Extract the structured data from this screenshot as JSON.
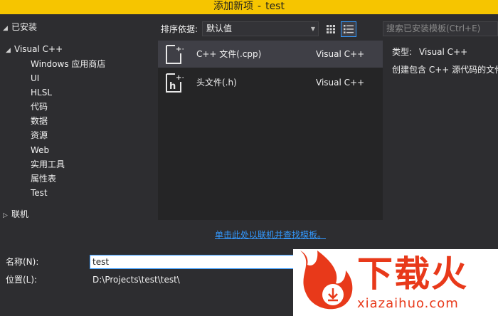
{
  "window": {
    "title": "添加新项",
    "project": "test"
  },
  "tree": {
    "installed": {
      "label": "已安装",
      "expanded": true
    },
    "visual_cpp": {
      "label": "Visual C++",
      "children": [
        "Windows 应用商店",
        "UI",
        "HLSL",
        "代码",
        "数据",
        "资源",
        "Web",
        "实用工具",
        "属性表",
        "Test"
      ]
    },
    "online": {
      "label": "联机",
      "expanded": false
    }
  },
  "toolbar": {
    "sort_label": "排序依据:",
    "sort_value": "默认值",
    "search_placeholder": "搜索已安装模板(Ctrl+E)"
  },
  "templates": [
    {
      "name": "C++ 文件(.cpp)",
      "lang": "Visual C++",
      "selected": true,
      "icon": "cpp-file-icon"
    },
    {
      "name": "头文件(.h)",
      "lang": "Visual C++",
      "selected": false,
      "icon": "header-file-icon"
    }
  ],
  "description": {
    "type_label": "类型:",
    "type_value": "Visual C++",
    "text": "创建包含 C++ 源代码的文件"
  },
  "online_link": "单击此处以联机并查找模板。",
  "fields": {
    "name_label": "名称(N):",
    "name_value": "test",
    "location_label": "位置(L):",
    "location_value": "D:\\Projects\\test\\test\\"
  },
  "watermark": {
    "cn": "下载火",
    "en": "xiazaihuo.com"
  },
  "colors": {
    "title_bar": "#f6c500",
    "accent": "#3399ff",
    "background": "#2d2d30",
    "watermark": "#e8391a"
  }
}
